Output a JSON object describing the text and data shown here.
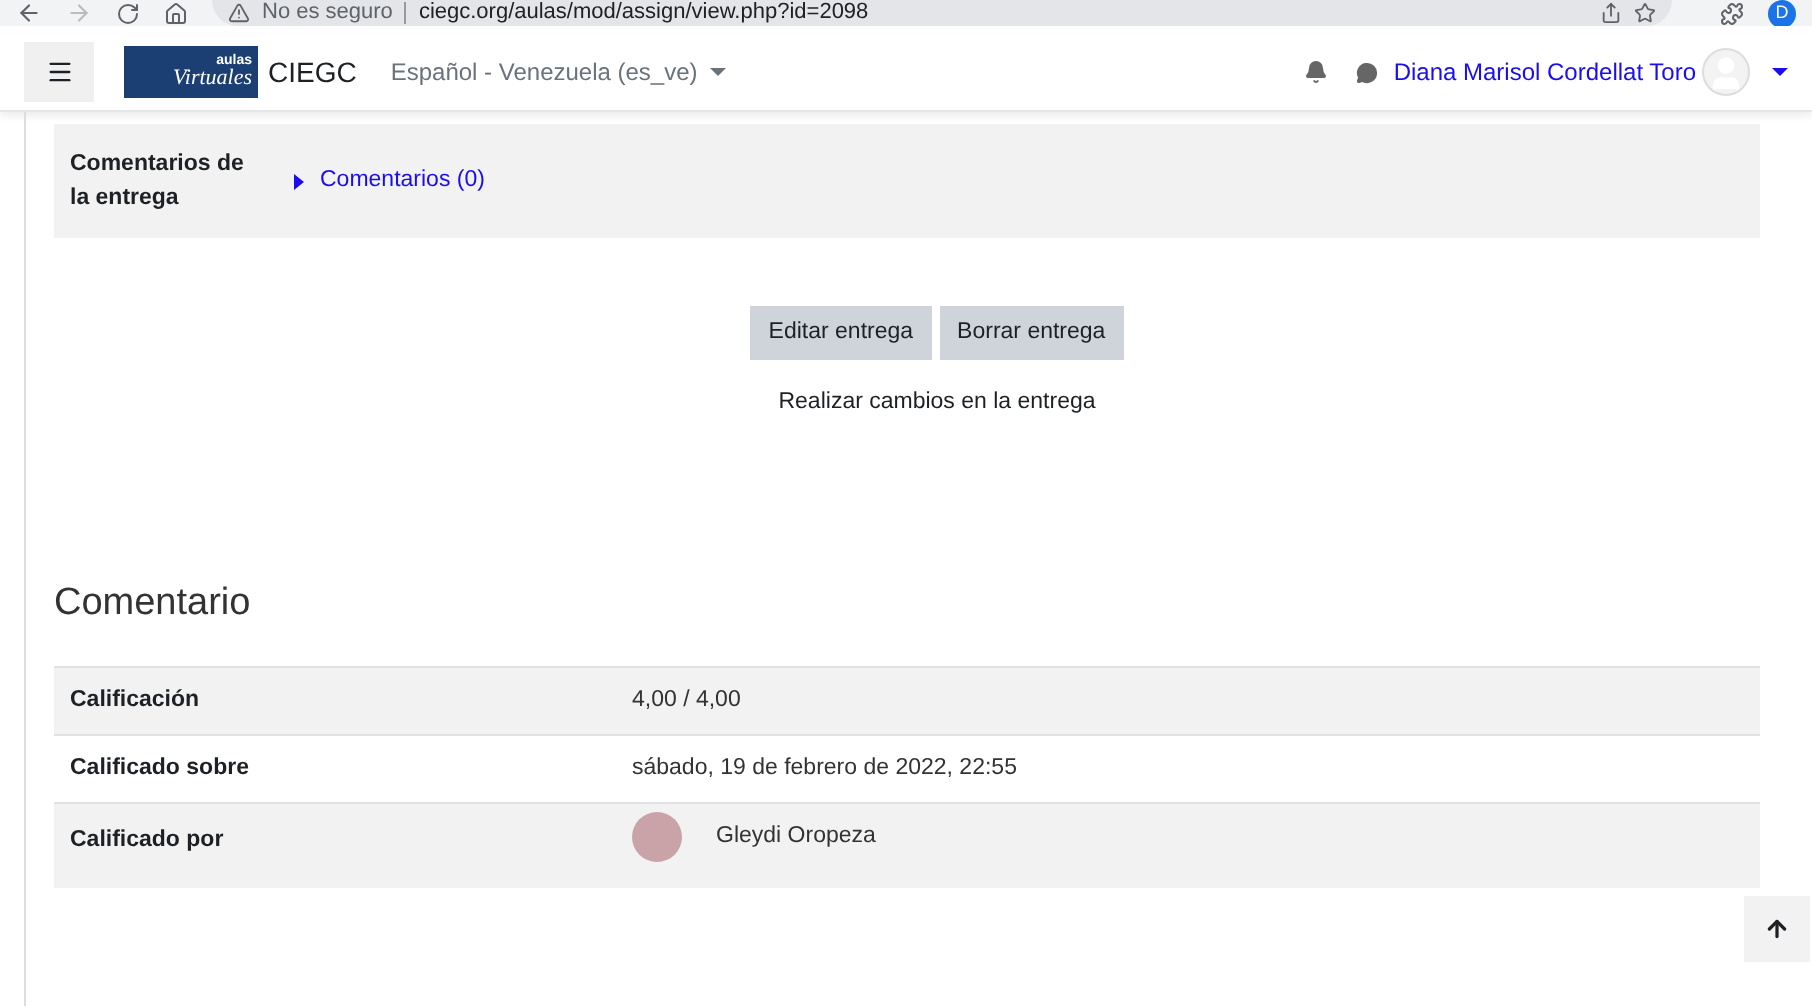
{
  "browser": {
    "security": "No es seguro",
    "url": "ciegc.org/aulas/mod/assign/view.php?id=2098",
    "profile": "D"
  },
  "navbar": {
    "logo_top": "aulas",
    "logo_main": "Virtuales",
    "site": "CIEGC",
    "language": "Español - Venezuela (es_ve)",
    "user": "Diana Marisol Cordellat Toro"
  },
  "submission_comments": {
    "label": "Comentarios de la entrega",
    "link": "Comentarios (0)",
    "expanded": false
  },
  "buttons": [
    "Editar entrega",
    "Borrar entrega"
  ],
  "buttons_note": "Realizar cambios en la entrega",
  "feedback": {
    "heading": "Comentario",
    "rows": [
      {
        "label": "Calificación",
        "value": "4,00 / 4,00",
        "kind": "text"
      },
      {
        "label": "Calificado sobre",
        "value": "sábado, 19 de febrero de 2022, 22:55",
        "kind": "text"
      },
      {
        "label": "Calificado por",
        "value": "Gleydi Oropeza",
        "kind": "user"
      }
    ]
  }
}
